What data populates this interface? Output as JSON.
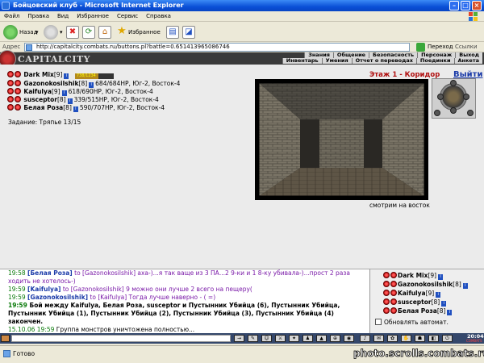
{
  "window": {
    "title": "Бойцовский клуб - Microsoft Internet Explorer"
  },
  "menu": [
    "Файл",
    "Правка",
    "Вид",
    "Избранное",
    "Сервис",
    "Справка"
  ],
  "toolbar": {
    "back_label": "Назад",
    "favorites_label": "Избранное"
  },
  "address": {
    "label": "Адрес",
    "url": "http://capitalcity.combats.ru/buttons.pl?battle=0.651413965086746",
    "go_label": "Переход",
    "links_label": "Ссылки"
  },
  "game_header": {
    "logo": "CAPITALCITY",
    "nav_top": [
      "Знания",
      "Общение",
      "Безопасность",
      "Персонаж",
      "Выход"
    ],
    "nav_bottom": [
      "Инвентарь",
      "Умения",
      "Отчет о переводах",
      "Поединки",
      "Анкета"
    ]
  },
  "players": [
    {
      "name": "Dark Mix",
      "level": "[9]",
      "hp": "738/1234",
      "hp_fraction": 0.6
    },
    {
      "name": "Gazonokosilshik",
      "level": "[8]",
      "info": "684/684HP, Юг-2, Восток-4"
    },
    {
      "name": "Kaifulya",
      "level": "[9]",
      "info": "618/690HP, Юг-2, Восток-4"
    },
    {
      "name": "susceptor",
      "level": "[8]",
      "info": "339/515HP, Юг-2, Восток-4"
    },
    {
      "name": "Белая Роза",
      "level": "[8]",
      "info": "590/707HP, Юг-2, Восток-4"
    }
  ],
  "task": "Задание: Тряпье 13/15",
  "location": {
    "title": "Этаж 1 - Коридор",
    "exit_label": "Выйти",
    "view_caption": "смотрим на восток"
  },
  "chat": [
    {
      "time": "19:58",
      "name": "[Белая Роза]",
      "text": "to [Gazonokosilshik] аха-)...я так ваще из 3 ПА...2 9-ки и 1 8-ку убивала-)...прост 2 раза ходить не хотелось-)"
    },
    {
      "time": "19:59",
      "name": "[Kaifulya]",
      "text": "to [Gazonokosilshik] 9 можно они лучше 2 всего на пещеру("
    },
    {
      "time": "19:59",
      "name": "[Gazonokosilshik]",
      "text": "to [Kaifulya] Тогда лучше наверно - ( =)"
    },
    {
      "time": "19:59",
      "pre": "Бой",
      "text": "между Kaifulya, Белая Роза, susceptor и Пустынник Убийца (6), Пустынник Убийца, Пустынник Убийца (1), Пустынник Убийца (2), Пустынник Убийца (3), Пустынник Убийца (4) закончен."
    },
    {
      "time": "15.10.06 19:59",
      "text": "Группа монстров уничтожена полностью..."
    }
  ],
  "online": {
    "players": [
      {
        "name": "Dark Mix",
        "level": "[9]"
      },
      {
        "name": "Gazonokosilshik",
        "level": "[8]"
      },
      {
        "name": "Kaifulya",
        "level": "[9]"
      },
      {
        "name": "susceptor",
        "level": "[8]"
      },
      {
        "name": "Белая Роза",
        "level": "[8]"
      }
    ],
    "auto_refresh_label": "Обновлять автомат."
  },
  "gamebar": {
    "clock": "20:04"
  },
  "status": {
    "text": "Готово",
    "watermark": "photo.scrolls.combats.ru"
  },
  "colors": {
    "titlebar": "#0a4fd6",
    "location": "#b01010",
    "chat_time": "#0a7a0a",
    "chat_to": "#7a1aa8"
  }
}
